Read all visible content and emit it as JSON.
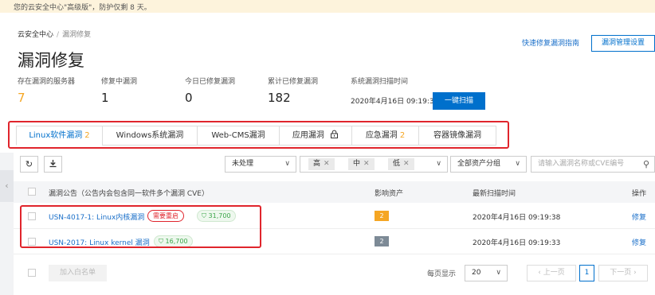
{
  "notice": "您的云安全中心\"高级版\"，防护仅剩 8 天。",
  "breadcrumb": {
    "root": "云安全中心",
    "separator": "/",
    "current": "漏洞修复"
  },
  "title": "漏洞修复",
  "links": {
    "guide": "快速修复漏洞指南",
    "manage": "漏洞管理设置"
  },
  "stats": [
    {
      "label": "存在漏洞的服务器",
      "value": "7"
    },
    {
      "label": "修复中漏洞",
      "value": "1"
    },
    {
      "label": "今日已修复漏洞",
      "value": "0"
    },
    {
      "label": "累计已修复漏洞",
      "value": "182"
    }
  ],
  "scan": {
    "label": "系统漏洞扫描时间",
    "time": "2020年4月16日 09:19:38",
    "button": "一键扫描"
  },
  "tabs": [
    {
      "label": "Linux软件漏洞",
      "count": "2"
    },
    {
      "label": "Windows系统漏洞",
      "count": ""
    },
    {
      "label": "Web-CMS漏洞",
      "count": ""
    },
    {
      "label": "应用漏洞",
      "count": ""
    },
    {
      "label": "应急漏洞",
      "count": "2"
    },
    {
      "label": "容器镜像漏洞",
      "count": ""
    }
  ],
  "toolbar": {
    "status_filter": "未处理",
    "levels": [
      "高",
      "中",
      "低"
    ],
    "asset_group": "全部资产分组",
    "search_placeholder": "请输入漏洞名称或CVE编号"
  },
  "table": {
    "headers": {
      "name": "漏洞公告（公告内会包含同一软件多个漏洞 CVE）",
      "assets": "影响资产",
      "scan_time": "最新扫描时间",
      "action": "操作"
    },
    "rows": [
      {
        "name": "USN-4017-1: Linux内核漏洞",
        "badge": "需要重启",
        "count": "31,700",
        "assets": "2",
        "scan_time": "2020年4月16日 09:19:38",
        "action": "修复"
      },
      {
        "name": "USN-2017: Linux kernel 漏洞",
        "badge": "",
        "count": "16,700",
        "assets": "2",
        "scan_time": "2020年4月16日 09:19:33",
        "action": "修复"
      }
    ]
  },
  "footer": {
    "whitelist": "加入白名单",
    "per_page_label": "每页显示",
    "per_page": "20",
    "prev": "上一页",
    "page": "1",
    "next": "下一页"
  },
  "colors": {
    "accent": "#0070cc",
    "highlight_red": "#e0252c",
    "warning_orange": "#f5a623"
  }
}
